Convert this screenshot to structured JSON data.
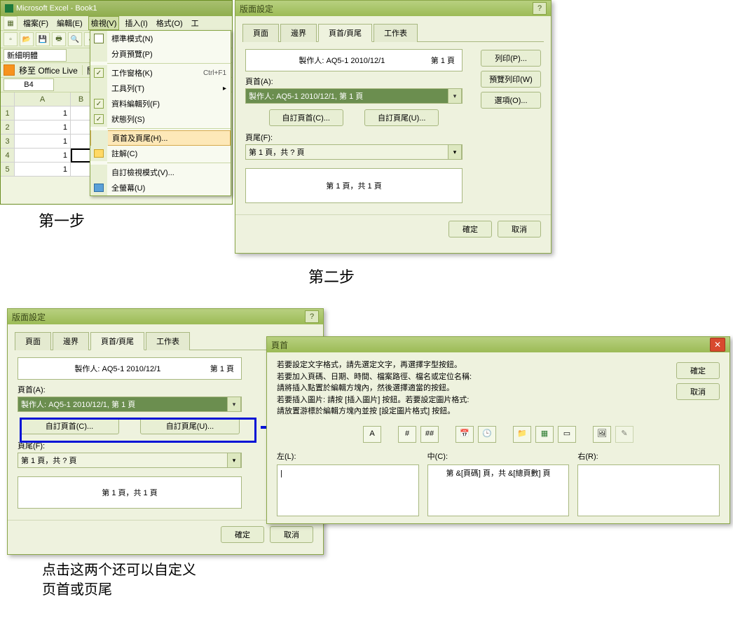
{
  "excel": {
    "title": "Microsoft Excel - Book1",
    "menus": [
      "檔案(F)",
      "編輯(E)",
      "檢視(V)",
      "插入(I)",
      "格式(O)",
      "工"
    ],
    "font": "新細明體",
    "live_label": "移至 Office Live",
    "live_btn": "開",
    "cellref": "B4",
    "col_hdrs": [
      "A",
      "B"
    ],
    "row_hdrs": [
      "1",
      "2",
      "3",
      "4",
      "5"
    ],
    "col_a": [
      "1",
      "1",
      "1",
      "1",
      "1"
    ]
  },
  "view_menu": {
    "items": [
      {
        "label": "標準模式(N)",
        "icon": "grid"
      },
      {
        "label": "分頁預覽(P)",
        "icon": ""
      },
      {
        "sep": true
      },
      {
        "label": "工作窗格(K)",
        "key": "Ctrl+F1",
        "chk": true
      },
      {
        "label": "工具列(T)",
        "arrow": true
      },
      {
        "label": "資料編輯列(F)",
        "chk": true
      },
      {
        "label": "狀態列(S)",
        "chk": true
      },
      {
        "sep": true
      },
      {
        "label": "頁首及頁尾(H)...",
        "hl": true
      },
      {
        "label": "註解(C)",
        "icon": "comment"
      },
      {
        "sep": true
      },
      {
        "label": "自訂檢視模式(V)..."
      },
      {
        "label": "全螢幕(U)",
        "icon": "full"
      }
    ]
  },
  "step1": "第一步",
  "step2": "第二步",
  "page_setup": {
    "title": "版面設定",
    "tab_page": "頁面",
    "tab_margin": "邊界",
    "tab_hf": "頁首/頁尾",
    "tab_sheet": "工作表",
    "header_preview_author": "製作人: AQ5-1 2010/12/1",
    "header_preview_page": "第 1 頁",
    "header_label": "頁首(A):",
    "header_drop": "製作人: AQ5-1 2010/12/1, 第 1 頁",
    "custom_header_btn": "自訂頁首(C)...",
    "custom_footer_btn": "自訂頁尾(U)...",
    "footer_label": "頁尾(F):",
    "footer_drop": "第 1 頁，共 ? 頁",
    "footer_preview": "第 1 頁，共 1 頁",
    "btn_print": "列印(P)...",
    "btn_preview": "預覽列印(W)",
    "btn_options": "選項(O)...",
    "ok": "確定",
    "cancel": "取消"
  },
  "header_dialog": {
    "title": "頁首",
    "help_line1": "若要設定文字格式，請先選定文字，再選擇字型按鈕。",
    "help_line2": "若要加入頁碼、日期、時間、檔案路徑、檔名或定位名稱:",
    "help_line2b": "   請將插入點置於編輯方塊內，然後選擇適當的按鈕。",
    "help_line3": "若要插入圖片: 請按 [插入圖片] 按鈕。若要設定圖片格式:",
    "help_line3b": "   請放置游標於編輯方塊內並按 [設定圖片格式] 按鈕。",
    "left_label": "左(L):",
    "center_label": "中(C):",
    "right_label": "右(R):",
    "center_content": "第 &[頁碼] 頁，共 &[總頁數] 頁",
    "ok": "確定",
    "cancel": "取消"
  },
  "note_text": "点击这两个还可以自定义\n页首或页尾"
}
